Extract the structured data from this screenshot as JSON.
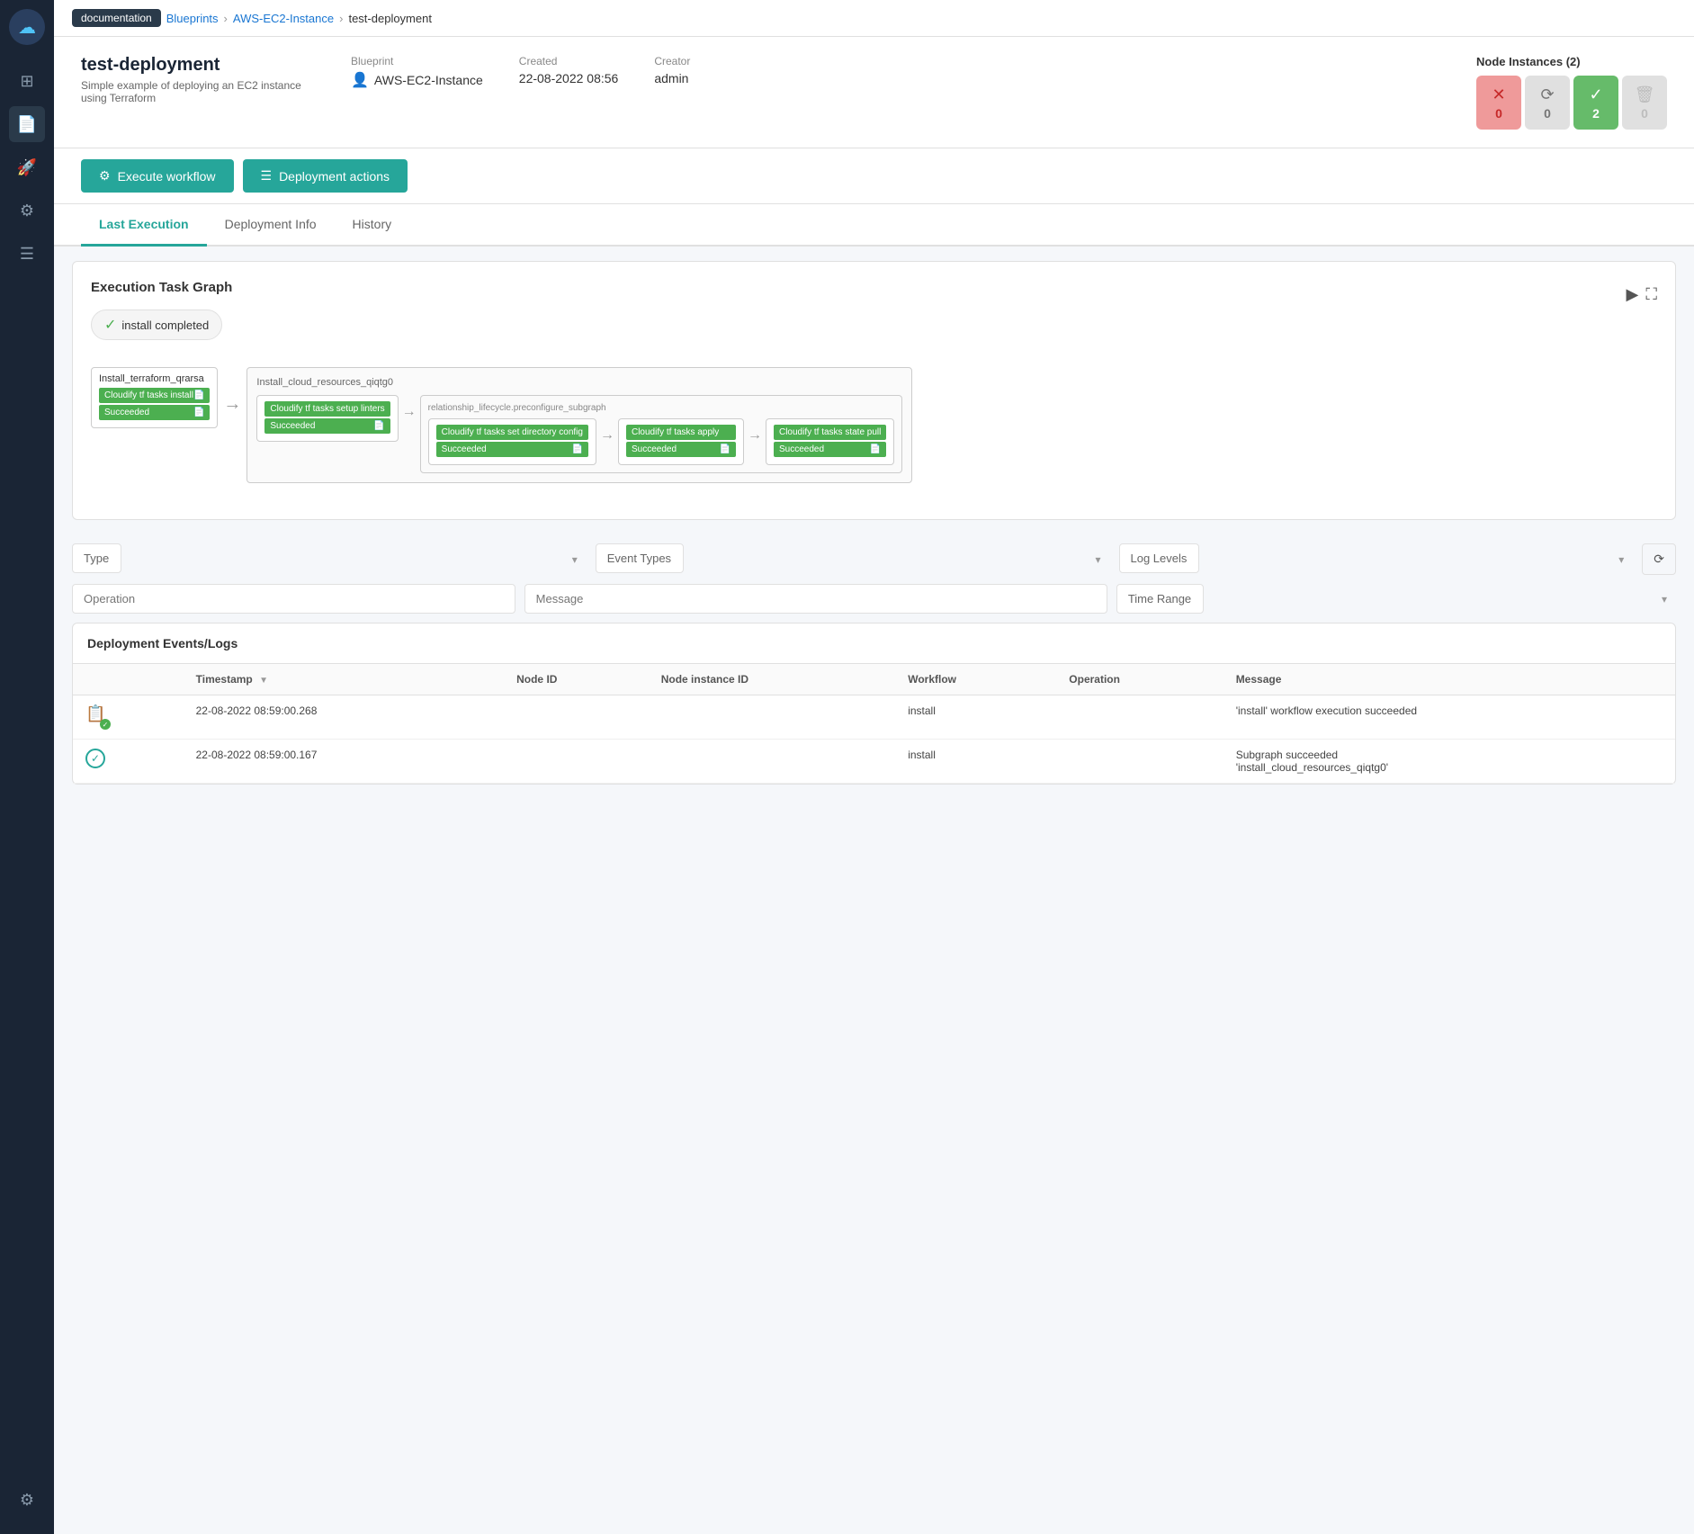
{
  "sidebar": {
    "logo": "☁",
    "items": [
      {
        "id": "deployments",
        "icon": "⊞",
        "active": false
      },
      {
        "id": "blueprints",
        "icon": "📋",
        "active": true
      },
      {
        "id": "workflows",
        "icon": "🚀",
        "active": false
      },
      {
        "id": "plugins",
        "icon": "⚙",
        "active": false
      },
      {
        "id": "logs",
        "icon": "☰",
        "active": false
      }
    ],
    "bottom_items": [
      {
        "id": "settings",
        "icon": "⚙",
        "active": false
      }
    ]
  },
  "breadcrumb": {
    "tag": "documentation",
    "links": [
      "Blueprints",
      "AWS-EC2-Instance"
    ],
    "current": "test-deployment"
  },
  "deployment": {
    "name": "test-deployment",
    "description": "Simple example of deploying an EC2 instance using Terraform",
    "blueprint_label": "Blueprint",
    "blueprint_name": "AWS-EC2-Instance",
    "created_label": "Created",
    "created_value": "22-08-2022 08:56",
    "creator_label": "Creator",
    "creator_value": "admin",
    "node_instances_label": "Node Instances (2)",
    "ni_error_count": "0",
    "ni_pending_count": "0",
    "ni_success_count": "2",
    "ni_deleted_count": "0"
  },
  "actions": {
    "execute_workflow": "Execute workflow",
    "deployment_actions": "Deployment actions"
  },
  "tabs": {
    "items": [
      "Last Execution",
      "Deployment Info",
      "History"
    ],
    "active": 0
  },
  "graph": {
    "title": "Execution Task Graph",
    "status": "install completed",
    "nodes": [
      {
        "id": "install_terraform",
        "label": "Install_terraform_qrarsa",
        "tasks": [
          {
            "name": "Cloudify tf tasks install",
            "status": "Succeeded"
          }
        ]
      }
    ],
    "subgraph": {
      "label": "Install_cloud_resources_qiqtg0",
      "inner_label": "relationship_lifecycle.preconfigure_subgraph",
      "tasks": [
        {
          "name": "Cloudify tf tasks setup linters",
          "status": "Succeeded"
        },
        {
          "name": "Cloudify tf tasks set directory config",
          "status": "Succeeded"
        },
        {
          "name": "Cloudify tf tasks apply",
          "status": "Succeeded"
        },
        {
          "name": "Cloudify tf tasks state pull",
          "status": "Succeeded"
        }
      ]
    }
  },
  "filters": {
    "type_placeholder": "Type",
    "event_types_placeholder": "Event Types",
    "log_levels_placeholder": "Log Levels",
    "operation_placeholder": "Operation",
    "message_placeholder": "Message",
    "time_range_placeholder": "Time Range"
  },
  "events_section": {
    "title": "Deployment Events/Logs",
    "columns": [
      "",
      "Timestamp",
      "Node ID",
      "Node instance ID",
      "Workflow",
      "Operation",
      "Message"
    ],
    "rows": [
      {
        "icon_type": "success_deploy",
        "timestamp": "22-08-2022 08:59:00.268",
        "node_id": "",
        "node_instance_id": "",
        "workflow": "install",
        "operation": "",
        "message": "'install' workflow execution succeeded"
      },
      {
        "icon_type": "check",
        "timestamp": "22-08-2022 08:59:00.167",
        "node_id": "",
        "node_instance_id": "",
        "workflow": "install",
        "operation": "",
        "message": "Subgraph succeeded\n'install_cloud_resources_qiqtg0'"
      }
    ]
  }
}
